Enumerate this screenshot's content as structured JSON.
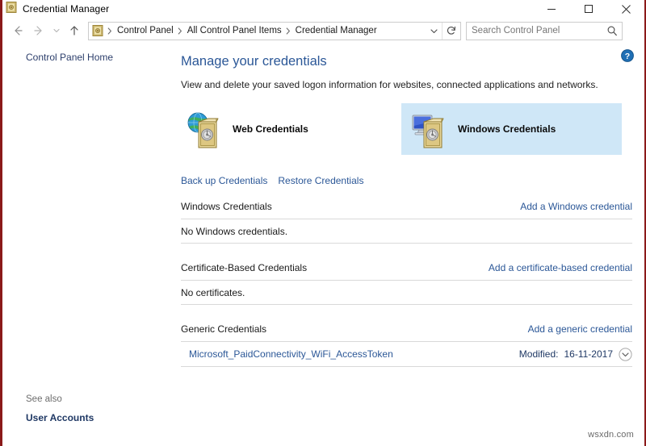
{
  "window": {
    "title": "Credential Manager",
    "icon": "vault-icon",
    "controls": {
      "minimize": "minimize-icon",
      "maximize": "maximize-icon",
      "close": "close-icon"
    }
  },
  "nav": {
    "back": "back-arrow-icon",
    "forward": "forward-arrow-icon",
    "recent": "chevron-down-icon",
    "up": "up-arrow-icon",
    "breadcrumb_icon": "vault-icon",
    "breadcrumb": [
      "Control Panel",
      "All Control Panel Items",
      "Credential Manager"
    ],
    "breadcrumb_dropdown": "chevron-down-icon",
    "refresh": "refresh-icon"
  },
  "search": {
    "placeholder": "Search Control Panel",
    "value": "",
    "icon": "search-icon"
  },
  "sidebar": {
    "home_link": "Control Panel Home",
    "see_also_label": "See also",
    "see_also_links": [
      "User Accounts"
    ]
  },
  "main": {
    "help_icon": "help-question-icon",
    "heading": "Manage your credentials",
    "subtext": "View and delete your saved logon information for websites, connected applications and networks.",
    "tiles": [
      {
        "label": "Web Credentials",
        "icon": "globe-vault-icon",
        "selected": false
      },
      {
        "label": "Windows Credentials",
        "icon": "monitor-vault-icon",
        "selected": true
      }
    ],
    "action_links": [
      "Back up Credentials",
      "Restore Credentials"
    ],
    "sections": [
      {
        "title": "Windows Credentials",
        "action": "Add a Windows credential",
        "empty_text": "No Windows credentials.",
        "entries": []
      },
      {
        "title": "Certificate-Based Credentials",
        "action": "Add a certificate-based credential",
        "empty_text": "No certificates.",
        "entries": []
      },
      {
        "title": "Generic Credentials",
        "action": "Add a generic credential",
        "empty_text": "",
        "entries": [
          {
            "name": "Microsoft_PaidConnectivity_WiFi_AccessToken",
            "modified_label": "Modified:",
            "modified_value": "16-11-2017",
            "expander_icon": "chevron-down-circle-icon"
          }
        ]
      }
    ]
  },
  "watermark": "wsxdn.com",
  "colors": {
    "accent_link": "#2b5797",
    "heading": "#2b5797",
    "tile_selected_bg": "#cfe7f7",
    "border": "#8b1a1a",
    "rule": "#d9d9d9"
  }
}
